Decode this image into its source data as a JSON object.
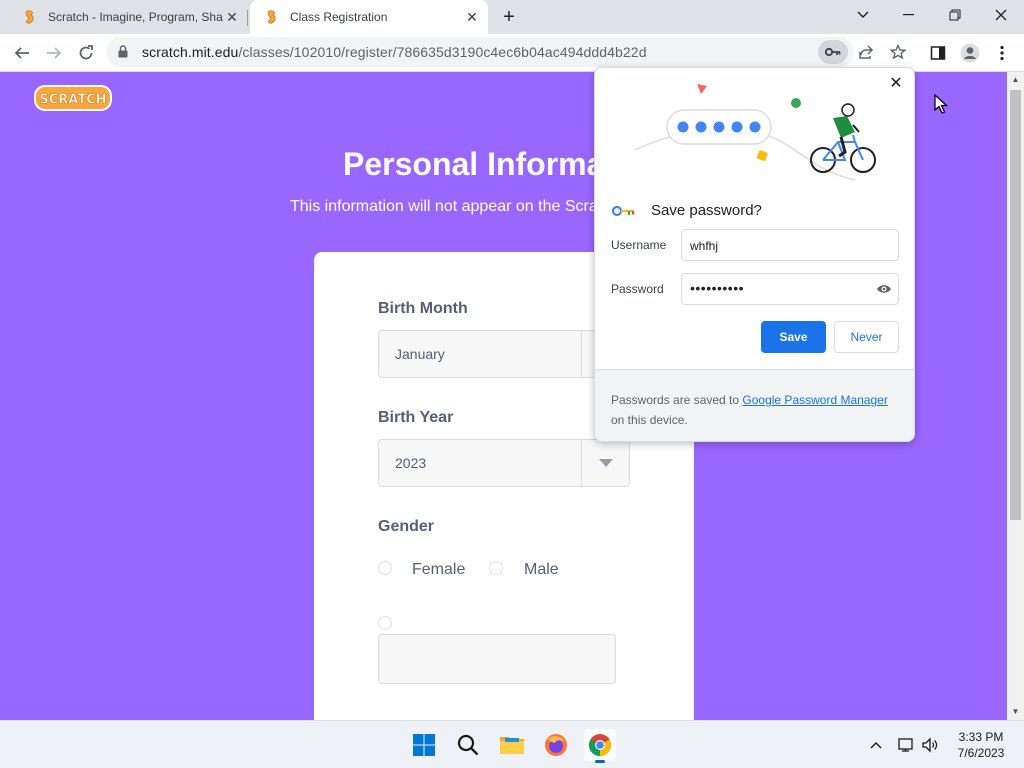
{
  "browser": {
    "tabs": [
      {
        "title": "Scratch - Imagine, Program, Share"
      },
      {
        "title": "Class Registration"
      }
    ],
    "url_host": "scratch.mit.edu",
    "url_path": "/classes/102010/register/786635d3190c4ec6b04ac494ddd4b22d"
  },
  "page": {
    "logo_text": "SCRATCH",
    "title": "Personal Information",
    "subtitle": "This information will not appear on the Scratch website.",
    "birth_month_label": "Birth Month",
    "birth_month_value": "January",
    "birth_year_label": "Birth Year",
    "birth_year_value": "2023",
    "gender_label": "Gender",
    "gender_options": [
      "Female",
      "Male"
    ]
  },
  "password_bubble": {
    "title": "Save password?",
    "username_label": "Username",
    "username_value": "whfhj",
    "password_label": "Password",
    "password_value": "••••••••••",
    "save_label": "Save",
    "never_label": "Never",
    "footer_before": "Passwords are saved to ",
    "footer_link": "Google Password Manager",
    "footer_after": " on this device."
  },
  "taskbar": {
    "time": "3:33 PM",
    "date": "7/6/2023"
  },
  "colors": {
    "page_bg": "#9966ff",
    "accent": "#1a73e8"
  }
}
